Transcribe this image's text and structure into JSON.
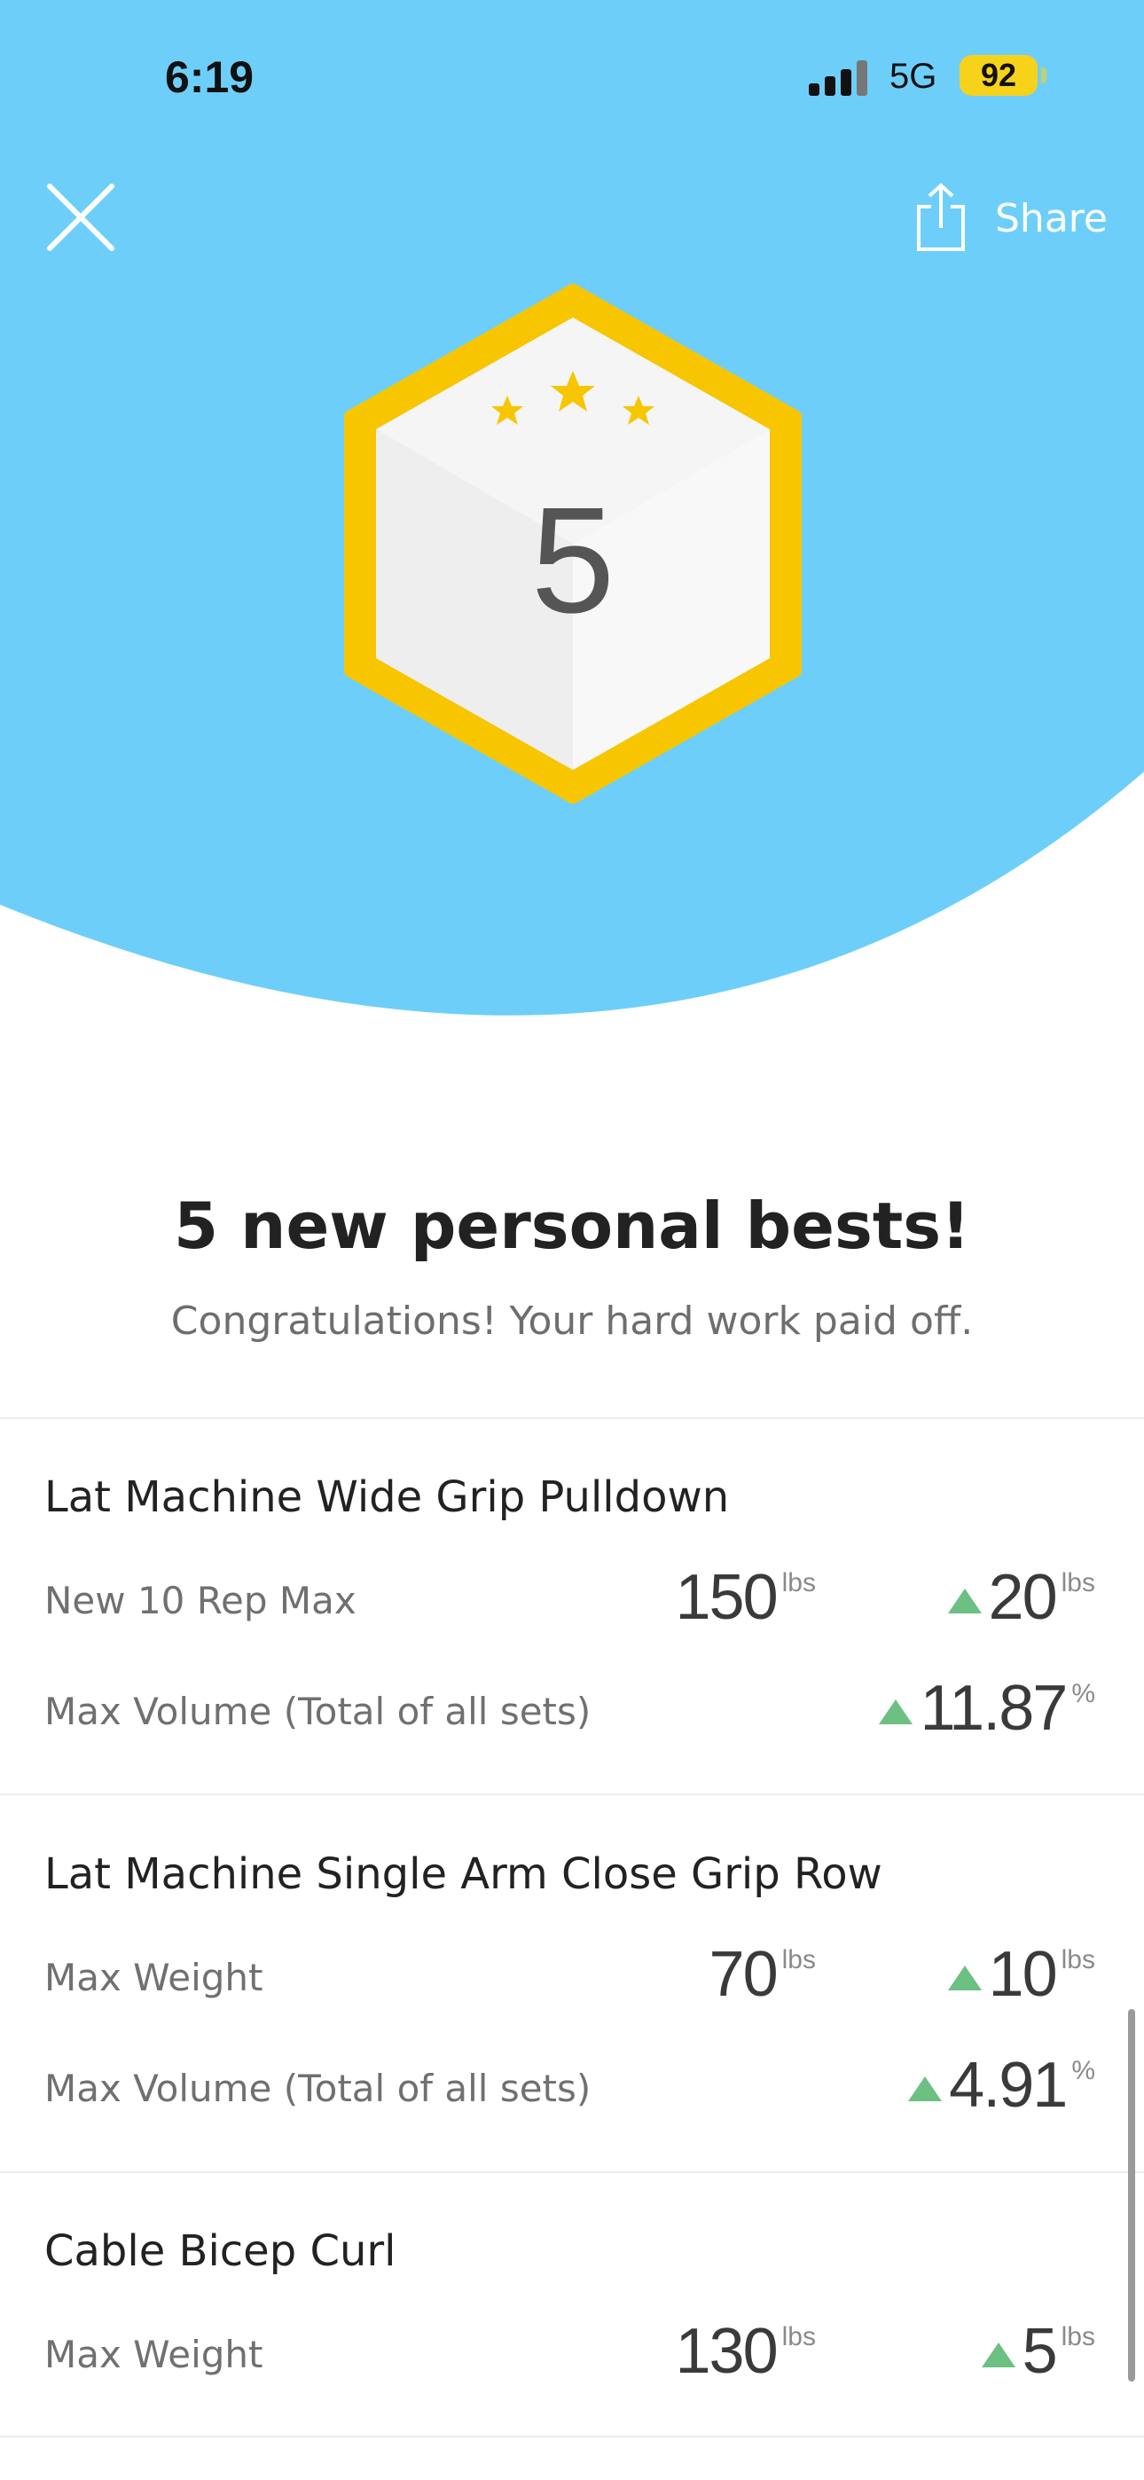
{
  "status_bar": {
    "time": "6:19",
    "network": "5G",
    "battery": "92"
  },
  "actions": {
    "share_label": "Share"
  },
  "badge": {
    "count": "5",
    "stars": 3
  },
  "colors": {
    "hero": "#6dcff9",
    "badge_ring": "#f7c600",
    "star": "#f7c600",
    "up_arrow": "#6cc082"
  },
  "header": {
    "headline": "5 new personal bests!",
    "subline": "Congratulations! Your hard work paid off."
  },
  "records": [
    {
      "exercise": "Lat Machine Wide Grip Pulldown",
      "metrics": [
        {
          "label": "New 10 Rep Max",
          "value": "150",
          "value_unit": "lbs",
          "change": "20",
          "change_unit": "lbs"
        },
        {
          "label": "Max Volume (Total of all sets)",
          "value": "",
          "value_unit": "",
          "change": "11.87",
          "change_unit": "%"
        }
      ]
    },
    {
      "exercise": "Lat Machine Single Arm Close Grip Row",
      "metrics": [
        {
          "label": "Max Weight",
          "value": "70",
          "value_unit": "lbs",
          "change": "10",
          "change_unit": "lbs"
        },
        {
          "label": "Max Volume (Total of all sets)",
          "value": "",
          "value_unit": "",
          "change": "4.91",
          "change_unit": "%"
        }
      ]
    },
    {
      "exercise": "Cable Bicep Curl",
      "metrics": [
        {
          "label": "Max Weight",
          "value": "130",
          "value_unit": "lbs",
          "change": "5",
          "change_unit": "lbs"
        }
      ]
    }
  ]
}
